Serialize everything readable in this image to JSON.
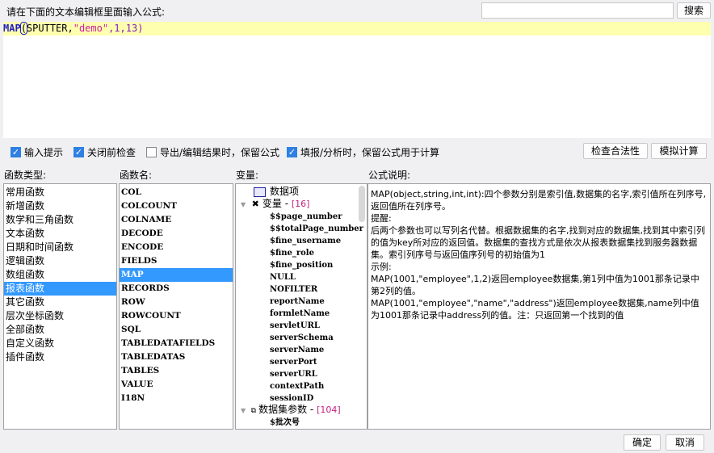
{
  "prompt": "请在下面的文本编辑框里面输入公式:",
  "search": {
    "value": "",
    "button": "搜索"
  },
  "formula": {
    "fn": "MAP",
    "open": "(",
    "arg1": "SPUTTER,",
    "arg2": "\"demo\"",
    "rest": ",1,13)"
  },
  "options": [
    {
      "label": "输入提示",
      "checked": true
    },
    {
      "label": "关闭前检查",
      "checked": true
    },
    {
      "label": "导出/编辑结果时，保留公式",
      "checked": false
    },
    {
      "label": "填报/分析时，保留公式用于计算",
      "checked": true
    }
  ],
  "actions": {
    "check": "检查合法性",
    "simulate": "模拟计算"
  },
  "labels": {
    "types": "函数类型:",
    "names": "函数名:",
    "vars": "变量:",
    "desc": "公式说明:"
  },
  "types": [
    "常用函数",
    "新增函数",
    "数学和三角函数",
    "文本函数",
    "日期和时间函数",
    "逻辑函数",
    "数组函数",
    "报表函数",
    "其它函数",
    "层次坐标函数",
    "全部函数",
    "自定义函数",
    "插件函数"
  ],
  "types_selected": 7,
  "names": [
    "COL",
    "COLCOUNT",
    "COLNAME",
    "DECODE",
    "ENCODE",
    "FIELDS",
    "MAP",
    "RECORDS",
    "ROW",
    "ROWCOUNT",
    "SQL",
    "TABLEDATAFIELDS",
    "TABLEDATAS",
    "TABLES",
    "VALUE",
    "I18N"
  ],
  "names_selected": 6,
  "tree": {
    "dataitem": "数据项",
    "vars_label": "变量 - ",
    "vars_count": "[16]",
    "vars": [
      "$$page_number",
      "$$totalPage_number",
      "$fine_username",
      "$fine_role",
      "$fine_position",
      "NULL",
      "NOFILTER",
      "reportName",
      "formletName",
      "servletURL",
      "serverSchema",
      "serverName",
      "serverPort",
      "serverURL",
      "contextPath",
      "sessionID"
    ],
    "ds_label": "数据集参数 - ",
    "ds_count": "[104]",
    "ds_first": "$批次号"
  },
  "description": [
    "MAP(object,string,int,int):四个参数分别是索引值,数据集的名字,索引值所在列序号,返回值所在列序号。",
    "提醒:",
    "后两个参数也可以写列名代替。根据数据集的名字,找到对应的数据集,找到其中索引列的值为key所对应的返回值。数据集的查找方式是依次从报表数据集找到服务器数据集。索引列序号与返回值序列号的初始值为1",
    "示例:",
    "MAP(1001,\"employee\",1,2)返回employee数据集,第1列中值为1001那条记录中第2列的值。",
    "MAP(1001,\"employee\",\"name\",\"address\")返回employee数据集,name列中值为1001那条记录中address列的值。注：只返回第一个找到的值"
  ],
  "footer": {
    "ok": "确定",
    "cancel": "取消"
  }
}
